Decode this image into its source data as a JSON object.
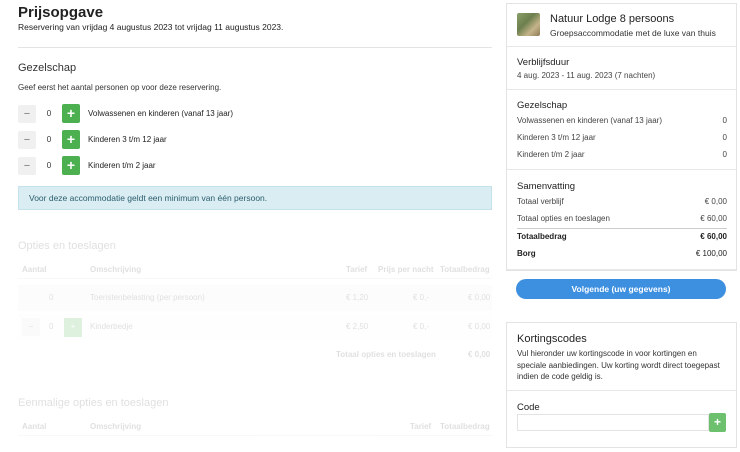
{
  "header": {
    "title": "Prijsopgave",
    "subtitle": "Reservering van vrijdag 4 augustus 2023 tot vrijdag 11 augustus 2023."
  },
  "party": {
    "title": "Gezelschap",
    "helper": "Geef eerst het aantal personen op voor deze reservering.",
    "rows": [
      {
        "label": "Volwassenen en kinderen (vanaf 13 jaar)",
        "count": "0",
        "minus": "−",
        "plus": "+"
      },
      {
        "label": "Kinderen 3 t/m 12 jaar",
        "count": "0",
        "minus": "−",
        "plus": "+"
      },
      {
        "label": "Kinderen t/m 2 jaar",
        "count": "0",
        "minus": "−",
        "plus": "+"
      }
    ]
  },
  "alert": {
    "text": "Voor deze accommodatie geldt een minimum van één persoon."
  },
  "options": {
    "title": "Opties en toeslagen",
    "columns": [
      "Aantal",
      "Omschrijving",
      "Tarief",
      "Prijs per nacht",
      "Totaalbedrag"
    ],
    "rows": [
      {
        "qty": "0",
        "desc": "Toeristenbelasting (per persoon)",
        "rate": "€ 1,20",
        "per_night": "€ 0,-",
        "total": "€ 0,00"
      },
      {
        "qty": "0",
        "desc": "Kinderbedje",
        "rate": "€ 2,50",
        "per_night": "€ 0,-",
        "total": "€ 0,00",
        "minus": "−",
        "plus": "+"
      }
    ],
    "total_label": "Totaal opties en toeslagen",
    "total_value": "€ 0,00"
  },
  "onetime": {
    "title": "Eenmalige opties en toeslagen",
    "columns": [
      "Aantal",
      "Omschrijving",
      "Tarief",
      "Totaalbedrag"
    ]
  },
  "summary_card": {
    "name": "Natuur Lodge 8 persoons",
    "description": "Groepsaccommodatie met de luxe van thuis",
    "stay_title": "Verblijfsduur",
    "stay_dates": "4 aug. 2023 - 11 aug. 2023 (7 nachten)",
    "party_title": "Gezelschap",
    "party_rows": [
      {
        "label": "Volwassenen en kinderen (vanaf 13 jaar)",
        "value": "0"
      },
      {
        "label": "Kinderen 3 t/m 12 jaar",
        "value": "0"
      },
      {
        "label": "Kinderen t/m 2 jaar",
        "value": "0"
      }
    ],
    "summary_title": "Samenvatting",
    "summary_rows": [
      {
        "label": "Totaal verblijf",
        "value": "€ 0,00"
      },
      {
        "label": "Totaal opties en toeslagen",
        "value": "€ 60,00"
      }
    ],
    "total_label": "Totaalbedrag",
    "total_value": "€ 60,00",
    "deposit_label": "Borg",
    "deposit_value": "€ 100,00",
    "next_button": "Volgende (uw gegevens)"
  },
  "discount": {
    "title": "Kortingscodes",
    "text": "Vul hieronder uw kortingscode in voor kortingen en speciale aanbiedingen. Uw korting wordt direct toegepast indien de code geldig is.",
    "code_label": "Code",
    "code_value": "",
    "add_button": "+"
  },
  "colors": {
    "plus_green": "#4caf50",
    "primary_blue": "#3d8fe0",
    "alert_bg": "#d9edf2"
  }
}
